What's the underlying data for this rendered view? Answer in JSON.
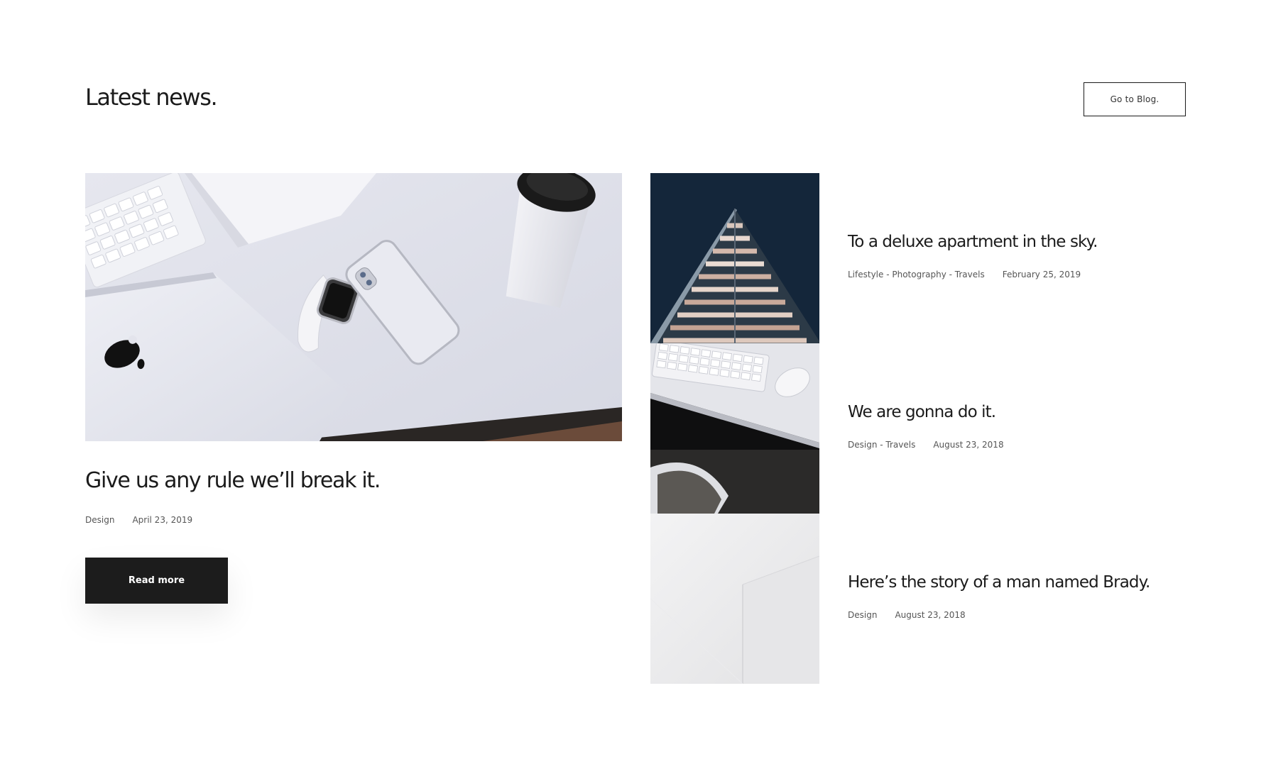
{
  "header": {
    "title": "Latest news.",
    "blog_button_label": "Go to Blog."
  },
  "featured": {
    "title": "Give us any rule we’ll break it.",
    "category": "Design",
    "date": "April 23, 2019",
    "read_more_label": "Read more"
  },
  "posts": [
    {
      "title": "To a deluxe apartment in the sky.",
      "categories": "Lifestyle - Photography - Travels",
      "date": "February 25, 2019"
    },
    {
      "title": "We are gonna do it.",
      "categories": "Design - Travels",
      "date": "August 23, 2018"
    },
    {
      "title": "Here’s the story of a man named Brady.",
      "categories": "Design",
      "date": "August 23, 2018"
    }
  ],
  "colors": {
    "text": "#1b1b1b",
    "button_dark": "#1c1c1c",
    "navy": "#14263a"
  }
}
